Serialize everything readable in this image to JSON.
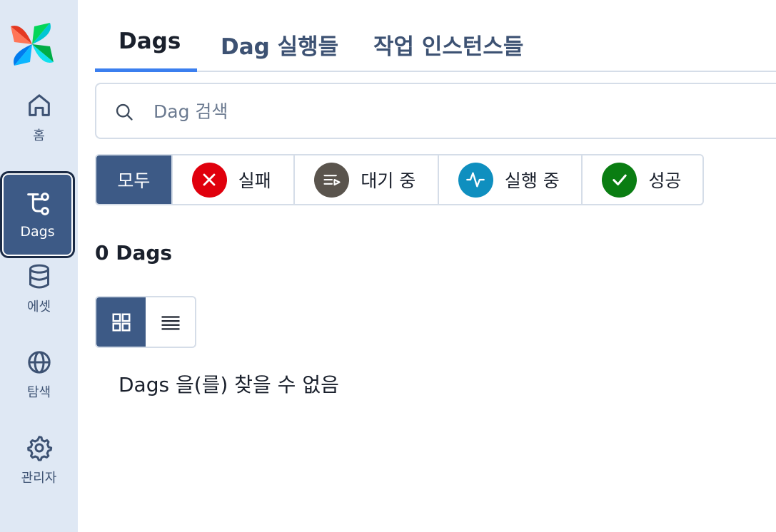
{
  "sidebar": {
    "items": [
      {
        "label": "홈",
        "icon": "home-icon"
      },
      {
        "label": "Dags",
        "icon": "dags-icon",
        "active": true
      },
      {
        "label": "에셋",
        "icon": "database-icon"
      },
      {
        "label": "탐색",
        "icon": "globe-icon"
      },
      {
        "label": "관리자",
        "icon": "gear-icon"
      }
    ]
  },
  "tabs": [
    {
      "label": "Dags",
      "active": true
    },
    {
      "label": "Dag 실행들"
    },
    {
      "label": "작업 인스턴스들"
    }
  ],
  "search": {
    "placeholder": "Dag 검색",
    "value": ""
  },
  "filters": {
    "all": "모두",
    "failed": "실패",
    "queued": "대기 중",
    "running": "실행 중",
    "success": "성공"
  },
  "colors": {
    "failed": "#e0000d",
    "queued": "#5a544d",
    "running": "#0f8fbf",
    "success": "#0a7d12",
    "accent": "#3d5a86",
    "tab_underline": "#3b7fef"
  },
  "count_title": "0 Dags",
  "view_toggle": {
    "active": "grid-view",
    "options": [
      "grid-view",
      "list-view"
    ]
  },
  "empty_message": "Dags 을(를) 찾을 수 없음"
}
